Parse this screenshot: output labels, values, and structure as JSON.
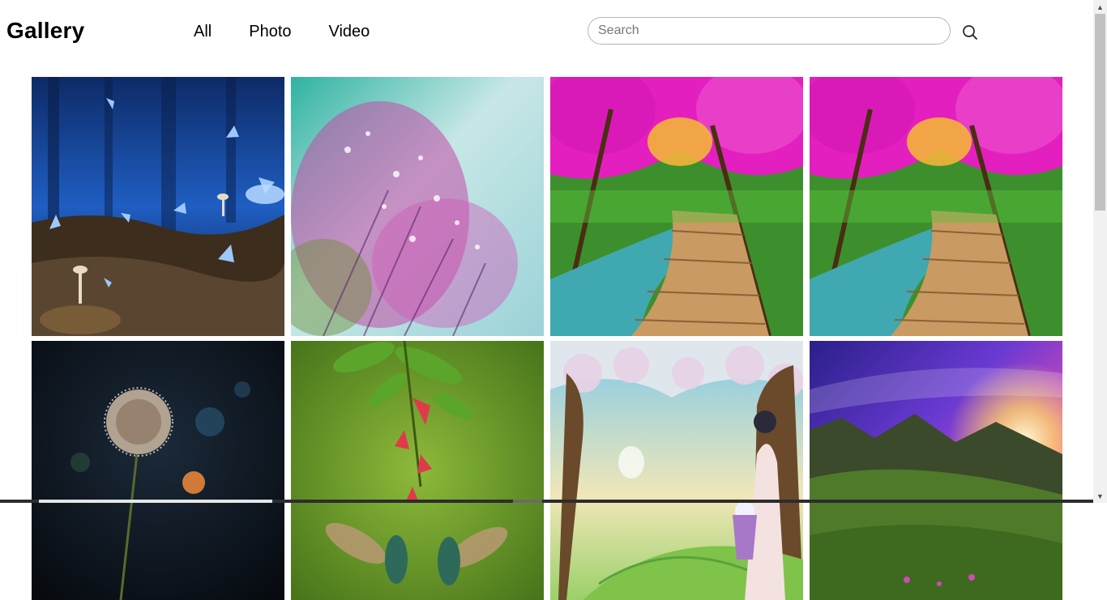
{
  "header": {
    "logo": "Gallery",
    "nav": [
      "All",
      "Photo",
      "Video"
    ],
    "search": {
      "placeholder": "Search",
      "value": ""
    },
    "search_icon": "search-icon"
  },
  "gallery": {
    "images": [
      {
        "name": "butterflies-night-forest"
      },
      {
        "name": "pink-dewdrop-flowers"
      },
      {
        "name": "pink-forest-boardwalk"
      },
      {
        "name": "pink-forest-boardwalk-2"
      },
      {
        "name": "dandelion-bokeh"
      },
      {
        "name": "hummingbirds-red-flower"
      },
      {
        "name": "cartoon-girl-blossom-tree"
      },
      {
        "name": "purple-sunset-mountains"
      }
    ]
  },
  "colors": {
    "background": "#ffffff",
    "text": "#000000",
    "search_border": "#b5b5b5",
    "scrollbar_track": "#f1f1f1",
    "scrollbar_thumb": "#c1c1c1"
  }
}
